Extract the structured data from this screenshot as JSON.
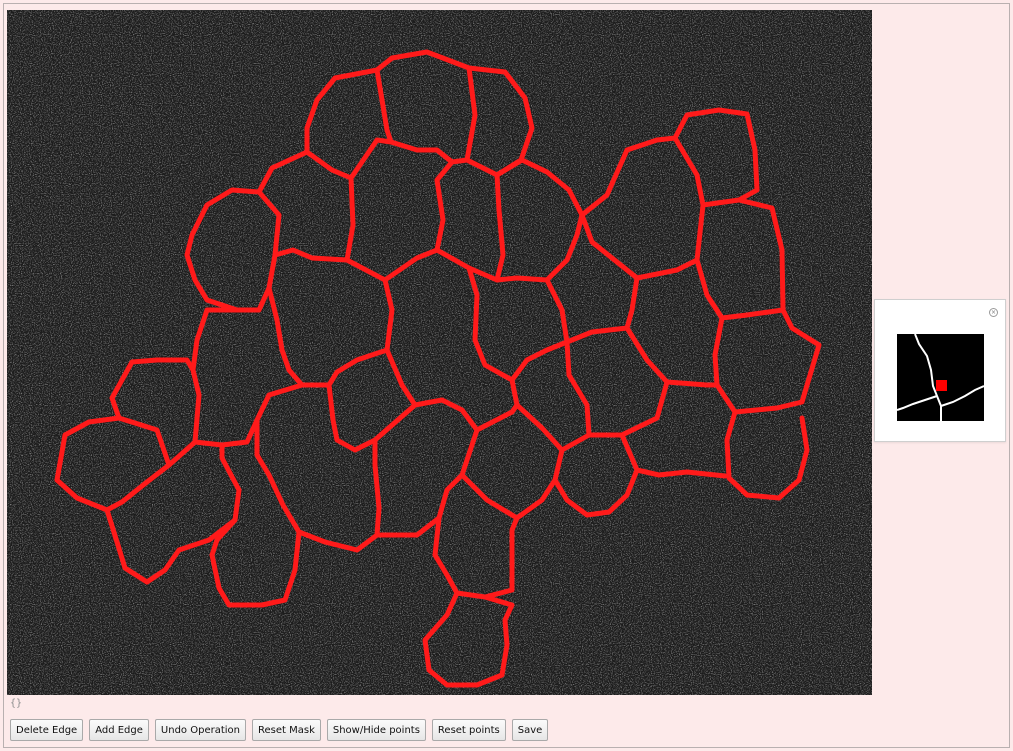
{
  "app": {
    "image_alt": "cell segmentation mask"
  },
  "readout": {
    "text": "{}"
  },
  "toolbar": {
    "buttons": [
      {
        "label": "Delete Edge"
      },
      {
        "label": "Add Edge"
      },
      {
        "label": "Undo Operation"
      },
      {
        "label": "Reset Mask"
      },
      {
        "label": "Show/Hide points"
      },
      {
        "label": "Reset points"
      },
      {
        "label": "Save"
      }
    ]
  },
  "preview": {
    "close_icon": "close-icon"
  },
  "colors": {
    "edge": "#ff1a1a",
    "background": "#fdeaea",
    "image_bg": "#1c1c1c",
    "zoom_line": "#ffffff",
    "zoom_point": "#ff0000"
  }
}
